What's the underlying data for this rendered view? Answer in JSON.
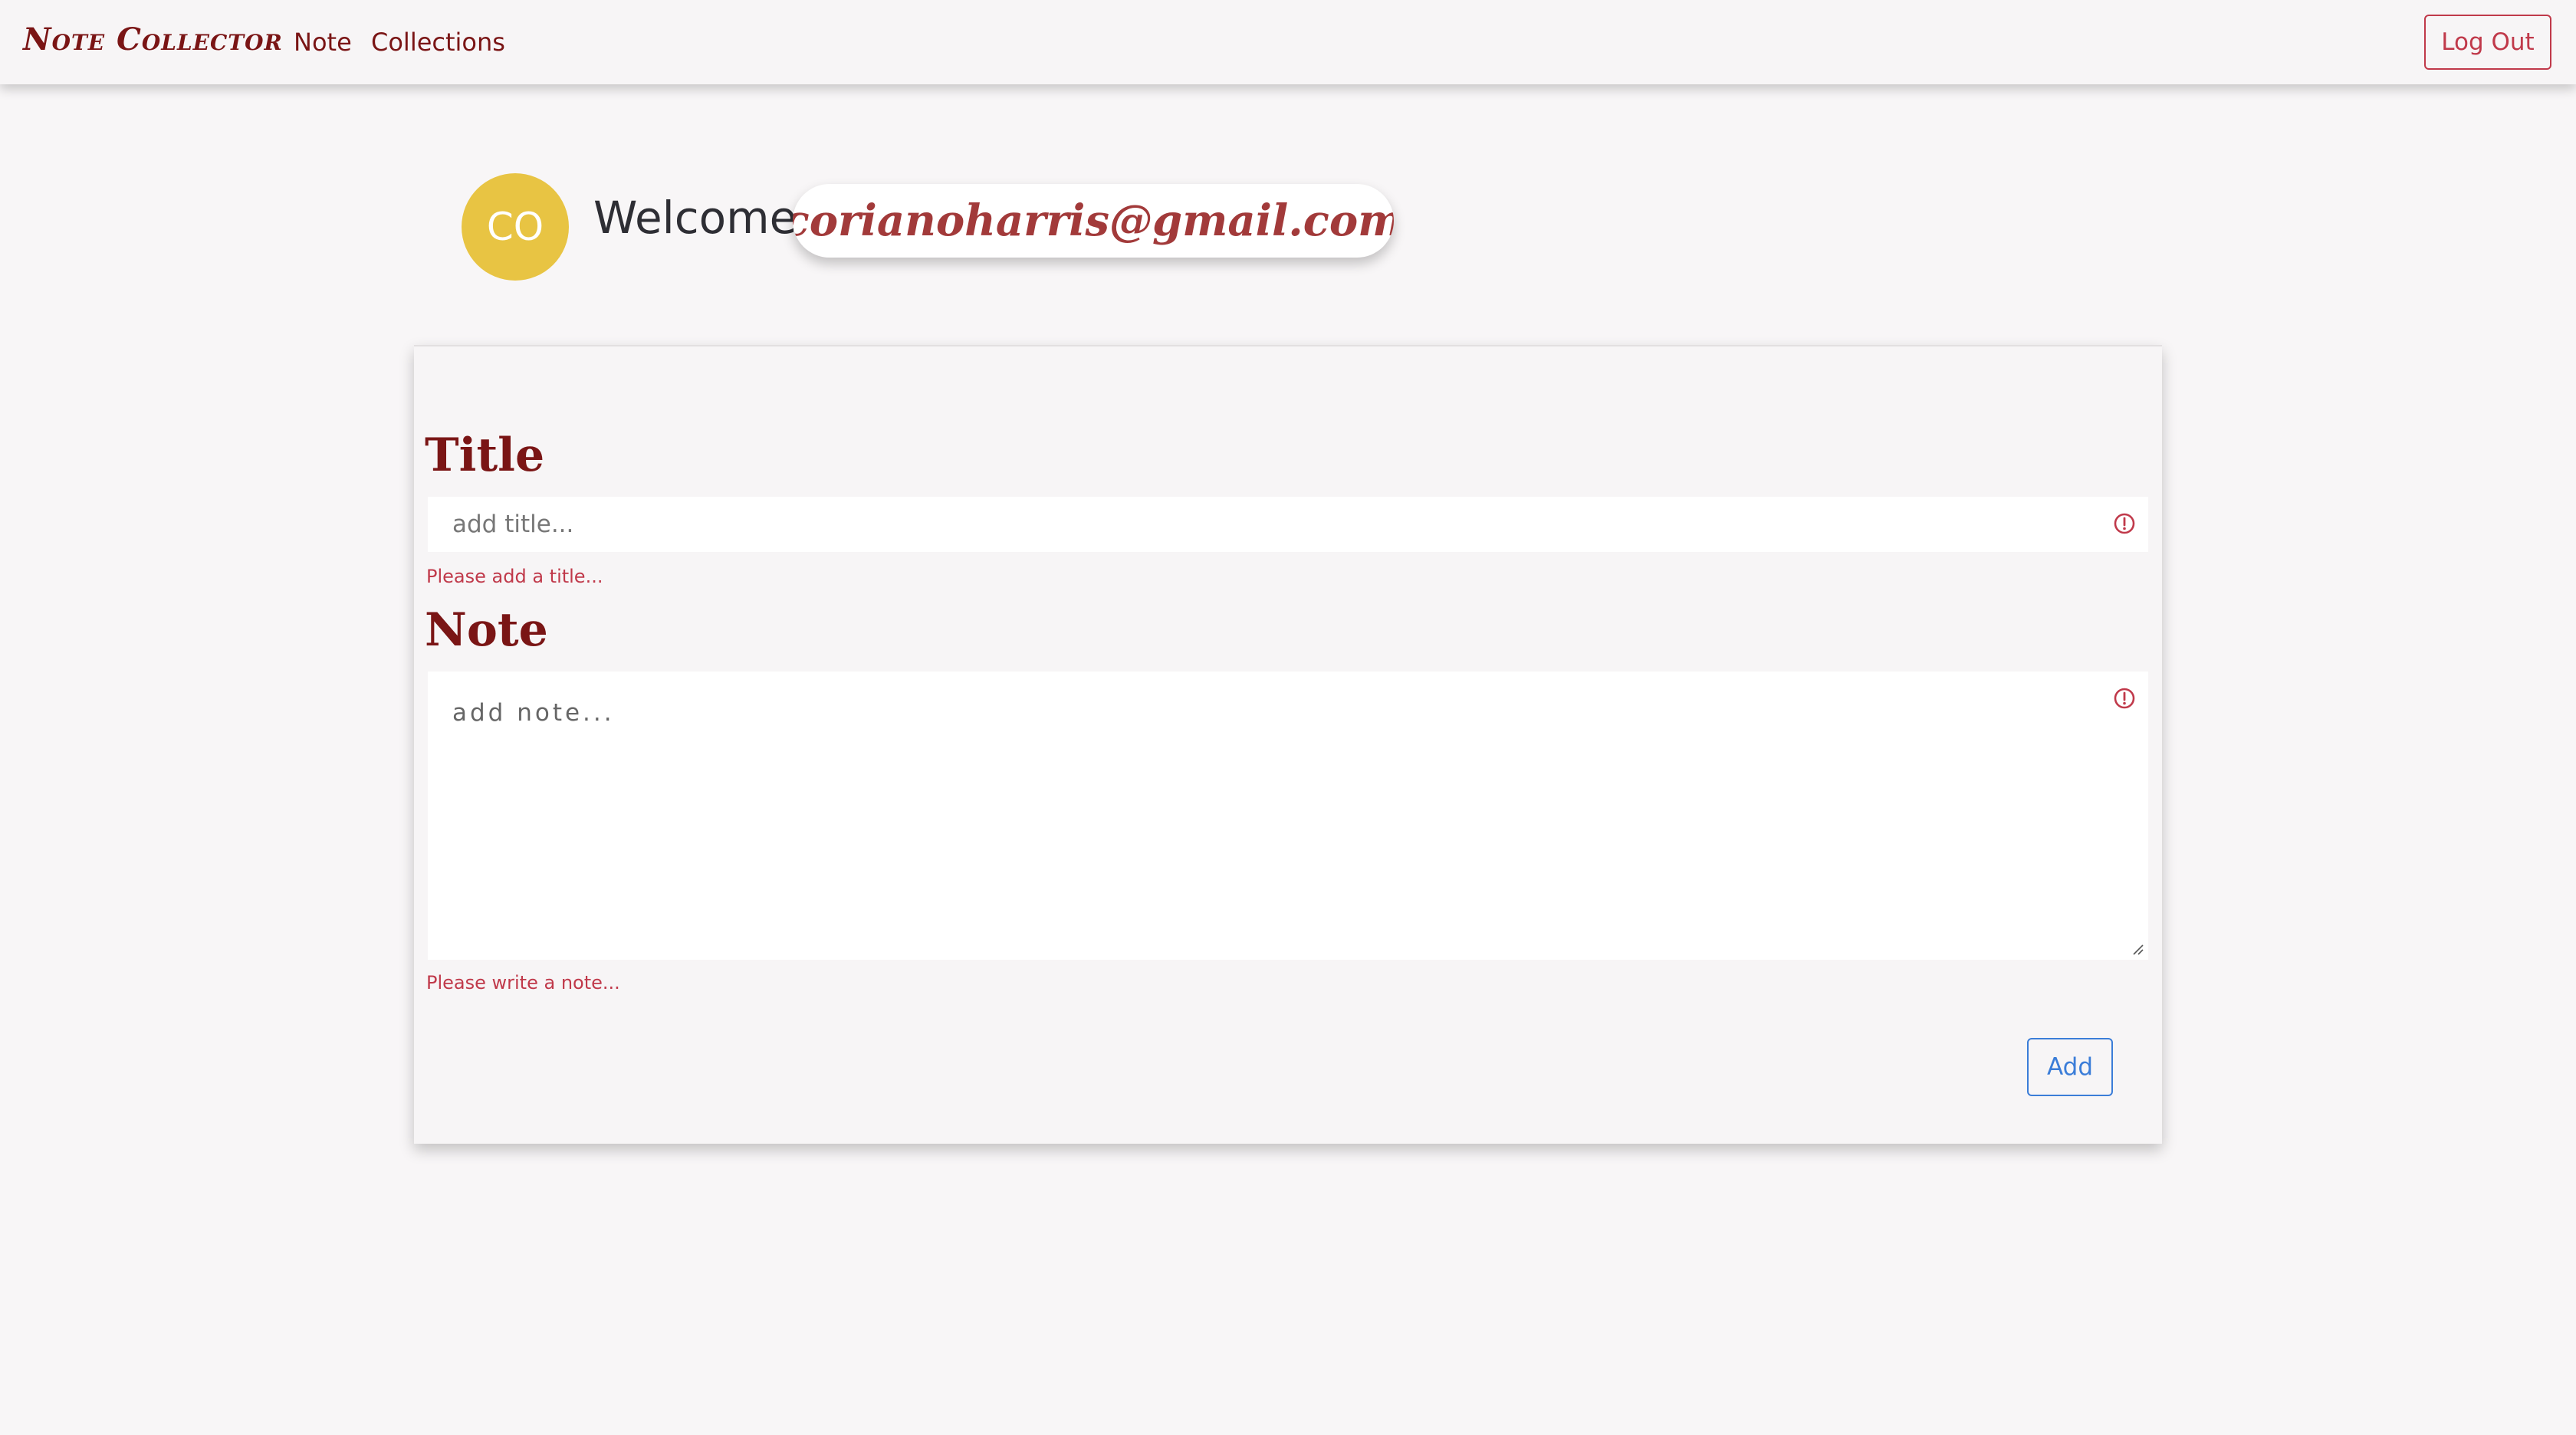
{
  "navbar": {
    "brand": "Note Collector",
    "links": [
      "Note",
      "Collections"
    ],
    "logout_label": "Log Out"
  },
  "welcome": {
    "avatar_initials": "CO",
    "greeting": "Welcome,",
    "email": "corianoharris@gmail.com"
  },
  "form": {
    "title": {
      "heading": "Title",
      "placeholder": "add title...",
      "value": "",
      "error": "Please add a title...",
      "icon": "exclamation-circle-icon"
    },
    "note": {
      "heading": "Note",
      "placeholder": "add note...",
      "value": "",
      "error": "Please write a note...",
      "icon": "exclamation-circle-icon"
    },
    "add_label": "Add"
  },
  "colors": {
    "brand": "#7a1515",
    "danger": "#c0394a",
    "primary": "#3b7dd8",
    "avatar": "#e8c443",
    "background": "#f8f6f7"
  }
}
